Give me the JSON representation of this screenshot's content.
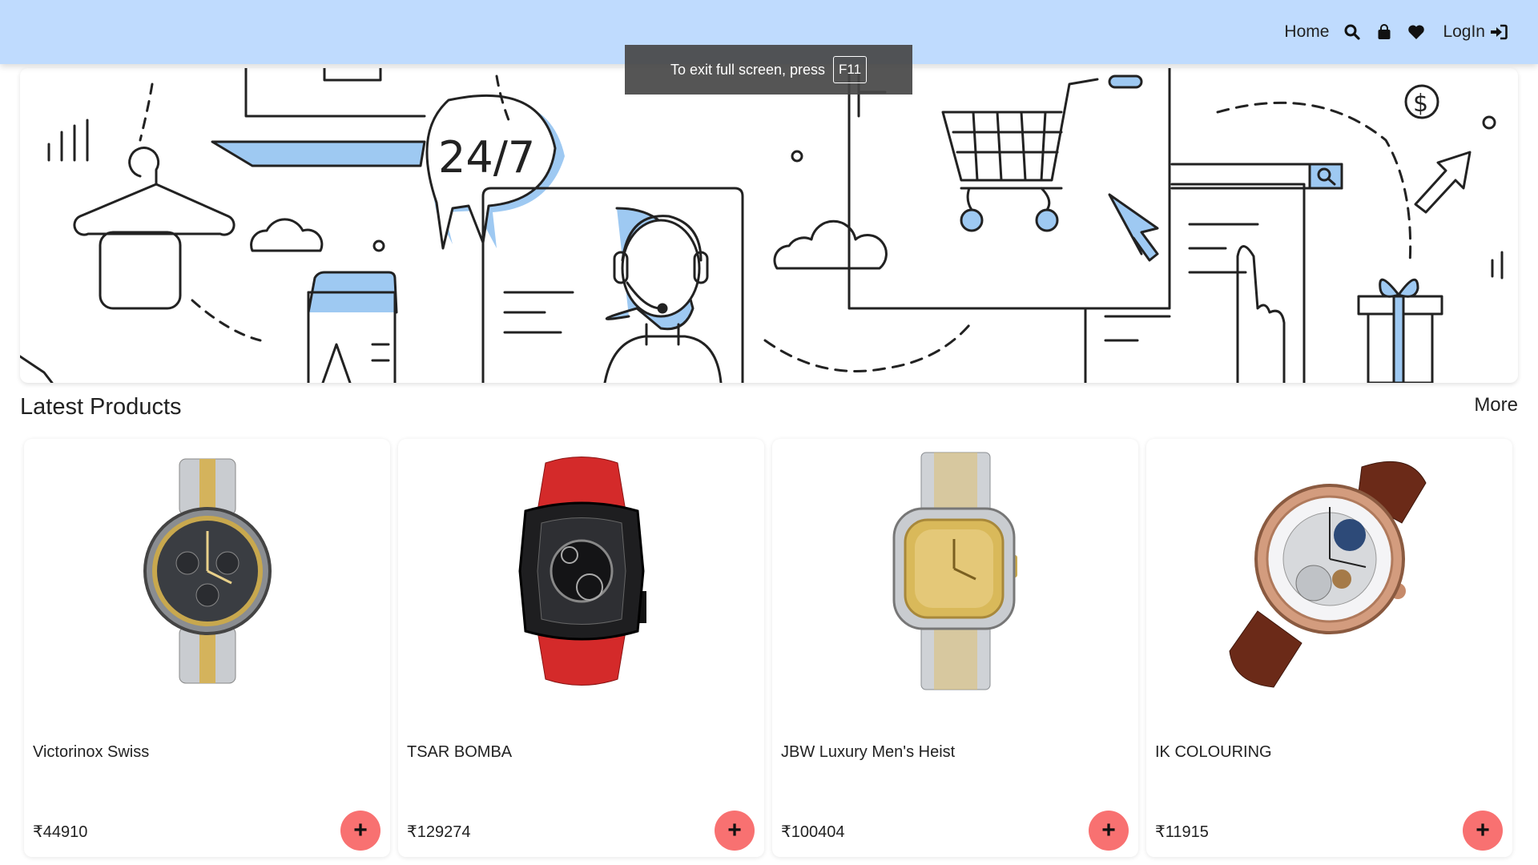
{
  "navbar": {
    "home_label": "Home",
    "login_label": "LogIn",
    "background": "#bfdbfe"
  },
  "fullscreen_toast": {
    "text": "To exit full screen, press",
    "key": "F11"
  },
  "banner": {
    "badge_text": "24/7",
    "accent_color": "#9ec9f2"
  },
  "section": {
    "title": "Latest Products",
    "more_label": "More"
  },
  "products": [
    {
      "name": "Victorinox Swiss",
      "price": "₹44910"
    },
    {
      "name": "TSAR BOMBA",
      "price": "₹129274"
    },
    {
      "name": "JBW Luxury Men's Heist",
      "price": "₹100404"
    },
    {
      "name": "IK COLOURING",
      "price": "₹11915"
    }
  ],
  "add_button_label": "+",
  "add_button_color": "#f87171",
  "icons": [
    "search-icon",
    "bag-icon",
    "heart-icon",
    "login-icon",
    "plus-icon"
  ]
}
